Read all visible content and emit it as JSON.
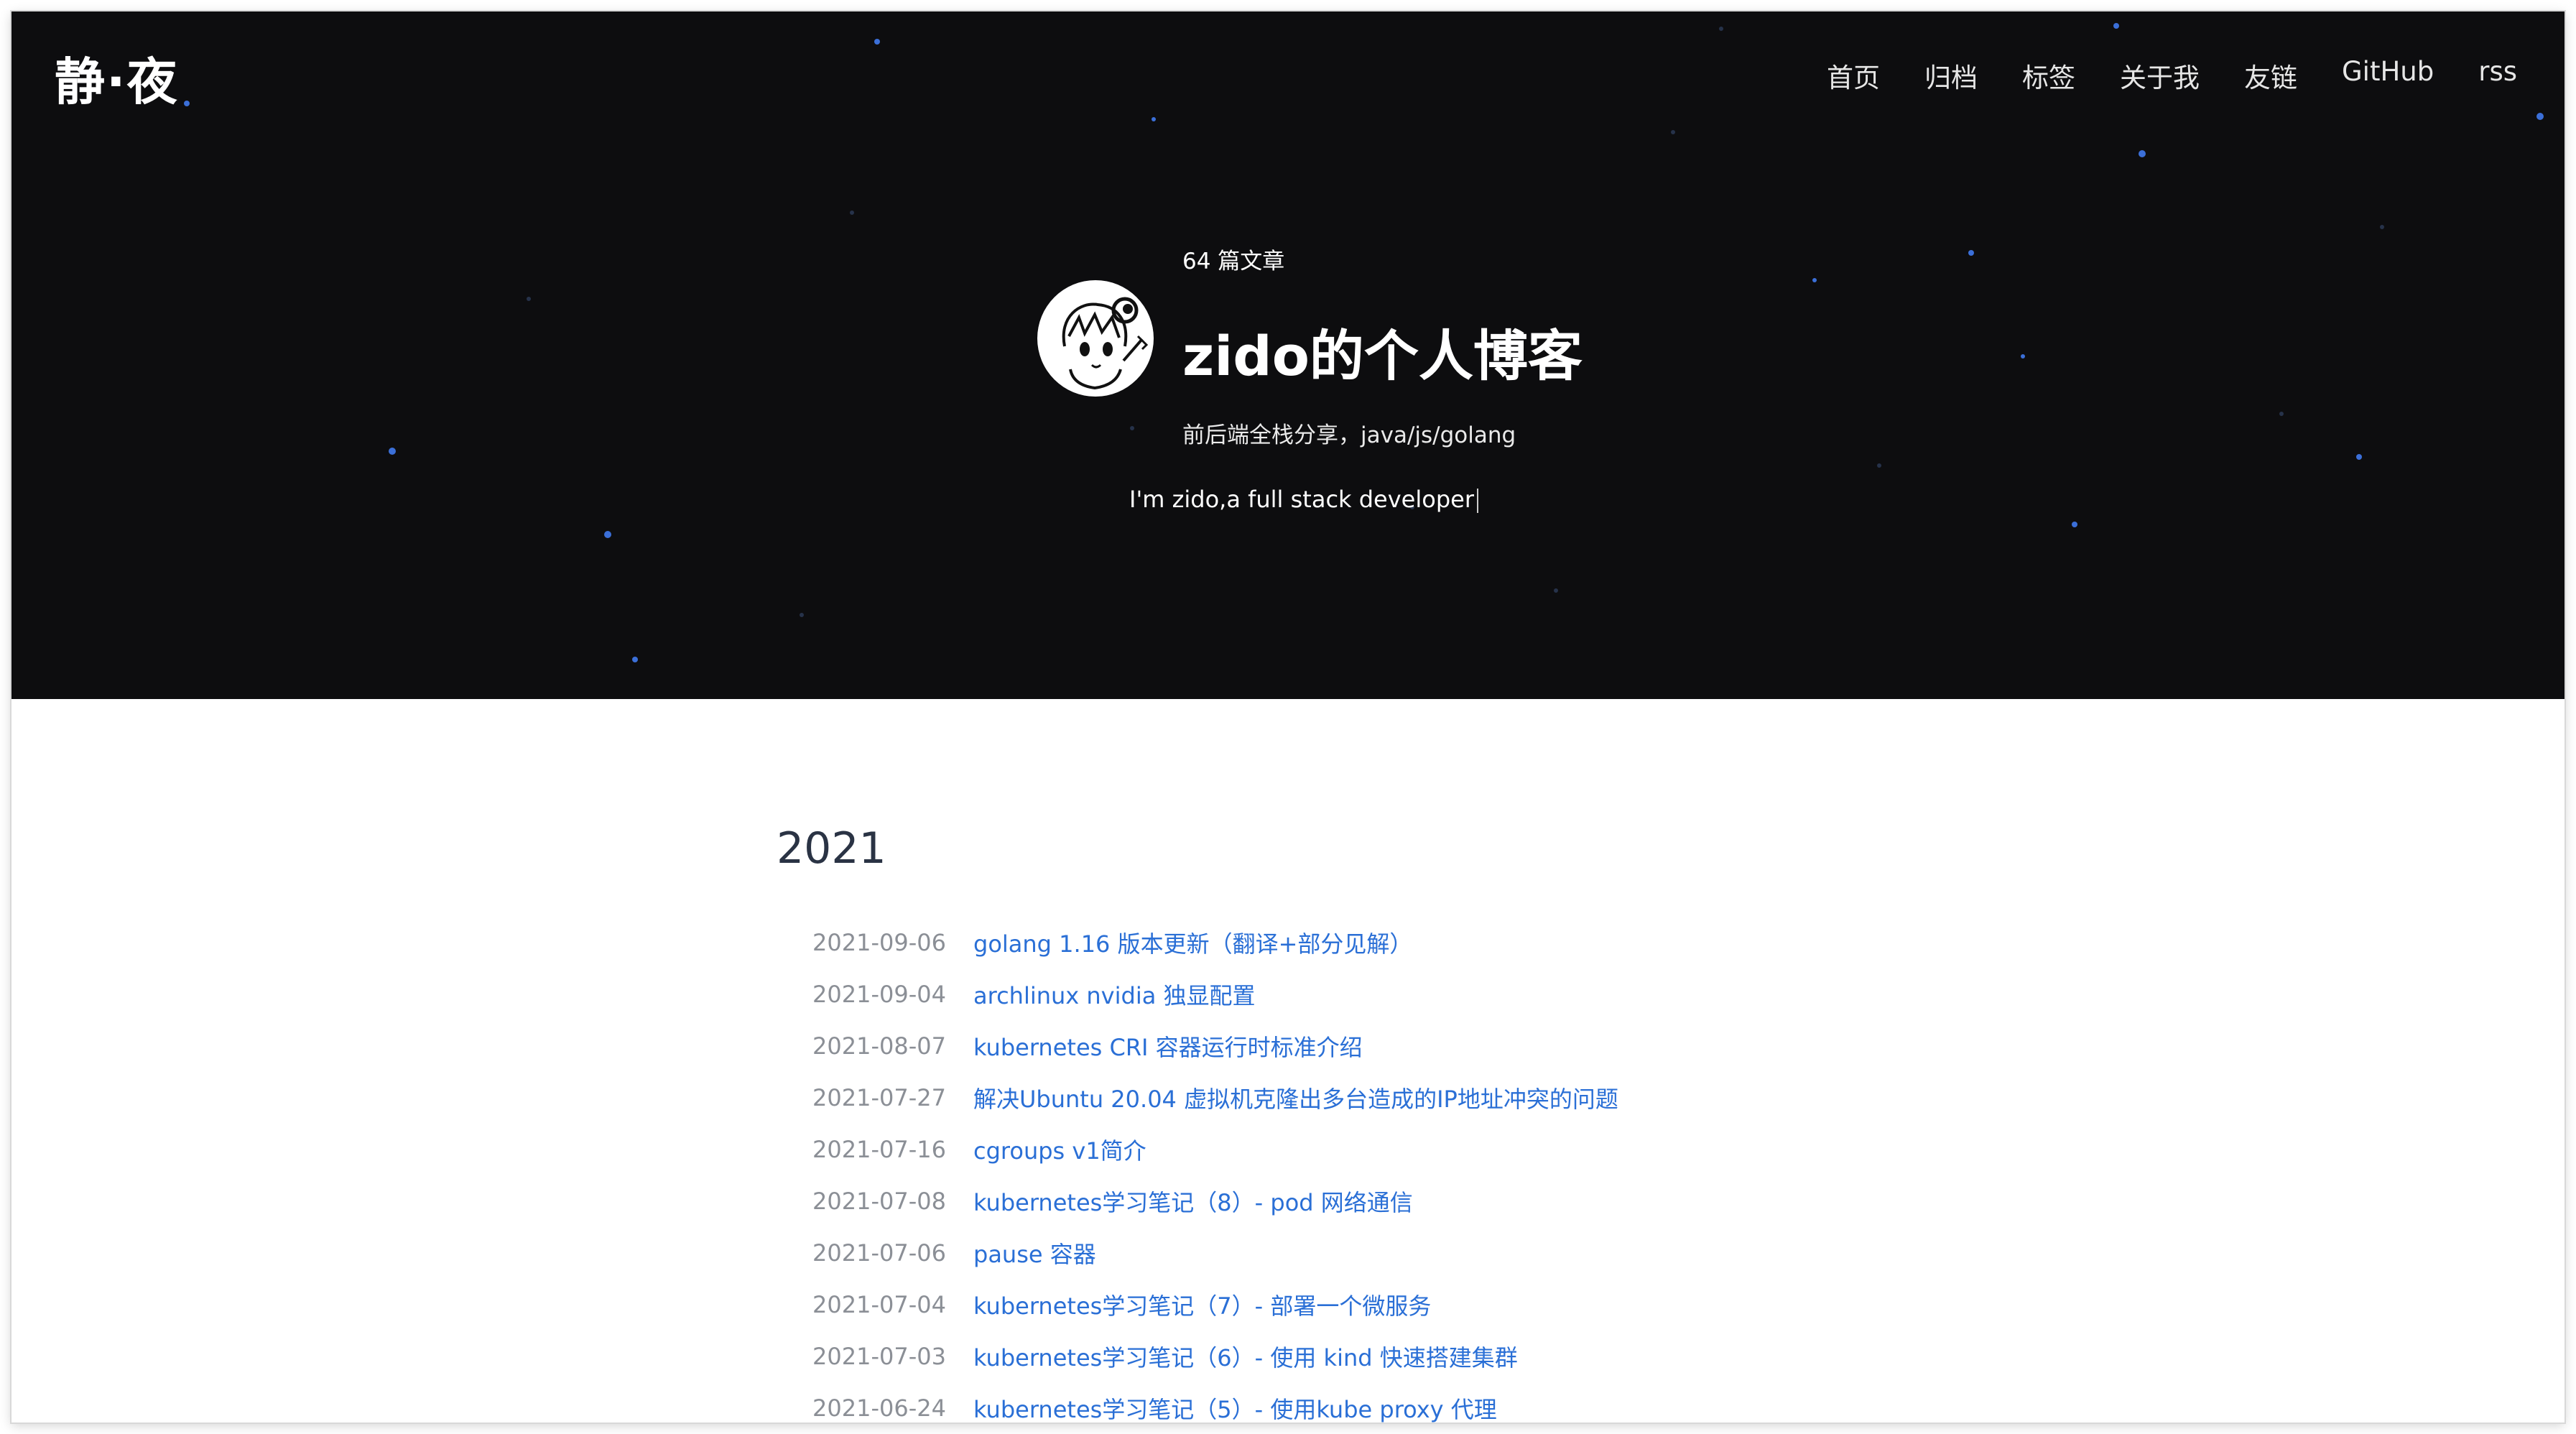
{
  "header": {
    "logo": "静·夜",
    "nav": [
      "首页",
      "归档",
      "标签",
      "关于我",
      "友链",
      "GitHub",
      "rss"
    ]
  },
  "profile": {
    "post_count": "64 篇文章",
    "title": "zido的个人博客",
    "subtitle": "前后端全栈分享，java/js/golang",
    "typed_text": "I'm zido,a full stack developer"
  },
  "archive": {
    "year": "2021",
    "posts": [
      {
        "date": "2021-09-06",
        "title": "golang 1.16 版本更新（翻译+部分见解）"
      },
      {
        "date": "2021-09-04",
        "title": "archlinux nvidia 独显配置"
      },
      {
        "date": "2021-08-07",
        "title": "kubernetes CRI 容器运行时标准介绍"
      },
      {
        "date": "2021-07-27",
        "title": "解决Ubuntu 20.04 虚拟机克隆出多台造成的IP地址冲突的问题"
      },
      {
        "date": "2021-07-16",
        "title": "cgroups v1简介"
      },
      {
        "date": "2021-07-08",
        "title": "kubernetes学习笔记（8）- pod 网络通信"
      },
      {
        "date": "2021-07-06",
        "title": "pause 容器"
      },
      {
        "date": "2021-07-04",
        "title": "kubernetes学习笔记（7）- 部署一个微服务"
      },
      {
        "date": "2021-07-03",
        "title": "kubernetes学习笔记（6）- 使用 kind 快速搭建集群"
      },
      {
        "date": "2021-06-24",
        "title": "kubernetes学习笔记（5）- 使用kube proxy 代理"
      }
    ]
  },
  "colors": {
    "hero_bg": "#0d0d0f",
    "link": "#2a6fd6",
    "date": "#8b8f96",
    "star": "#3b6fd8"
  }
}
